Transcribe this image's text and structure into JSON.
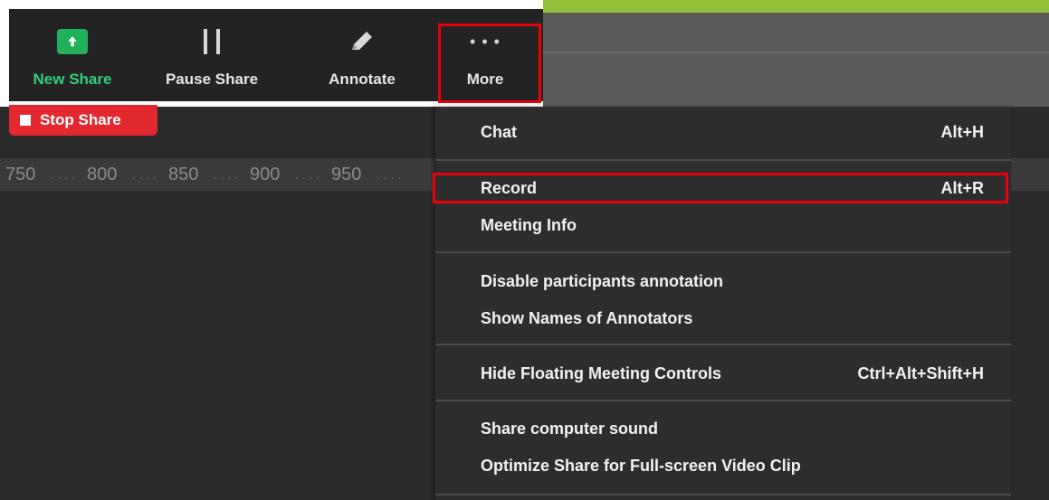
{
  "toolbar": {
    "new_share": "New Share",
    "pause_share": "Pause Share",
    "annotate": "Annotate",
    "more": "More",
    "more_glyph": "• • •"
  },
  "stop_share": "Stop Share",
  "ruler": {
    "labels": [
      "750",
      "800",
      "850",
      "900",
      "950"
    ],
    "dots": ". . . ."
  },
  "menu": {
    "chat": {
      "label": "Chat",
      "shortcut": "Alt+H"
    },
    "record": {
      "label": "Record",
      "shortcut": "Alt+R"
    },
    "meeting_info": {
      "label": "Meeting Info"
    },
    "disable_annotation": {
      "label": "Disable participants annotation"
    },
    "show_names": {
      "label": "Show Names of Annotators"
    },
    "hide_controls": {
      "label": "Hide Floating Meeting Controls",
      "shortcut": "Ctrl+Alt+Shift+H"
    },
    "share_sound": {
      "label": "Share computer sound"
    },
    "optimize_video": {
      "label": "Optimize Share for Full-screen Video Clip"
    }
  },
  "colors": {
    "new_share_green": "#21b15a",
    "stop_red": "#e4282f",
    "highlight_red": "#e8000b",
    "accent_green": "#93c23a"
  },
  "icons": {
    "new_share": "up-arrow-icon",
    "pause_share": "pause-icon",
    "annotate": "pencil-icon",
    "more": "ellipsis-icon"
  }
}
